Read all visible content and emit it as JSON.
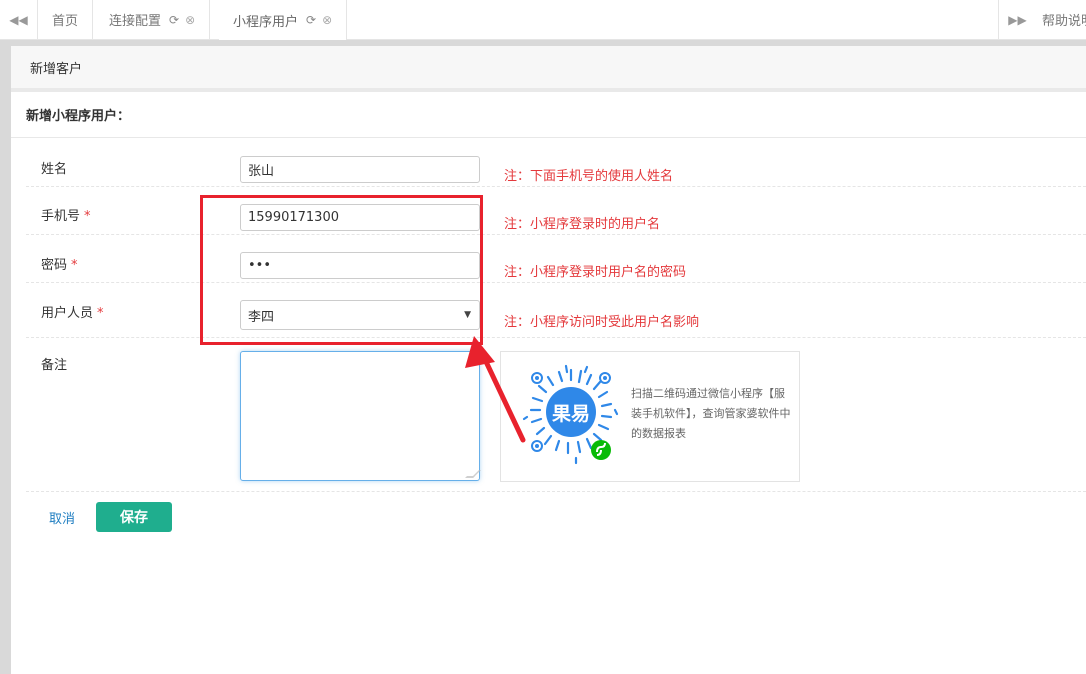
{
  "tabs": {
    "items": [
      {
        "label": "首页"
      },
      {
        "label": "连接配置"
      },
      {
        "label": "小程序用户"
      }
    ],
    "help_label": "帮助说明"
  },
  "panel": {
    "title": "新增客户",
    "section_title": "新增小程序用户："
  },
  "form": {
    "name": {
      "label": "姓名",
      "value": "张山",
      "note": "注：下面手机号的使用人姓名"
    },
    "phone": {
      "label": "手机号",
      "required_mark": "*",
      "value": "15990171300",
      "note": "注：小程序登录时的用户名"
    },
    "password": {
      "label": "密码",
      "required_mark": "*",
      "value": "•••",
      "note": "注：小程序登录时用户名的密码"
    },
    "user_person": {
      "label": "用户人员",
      "required_mark": "*",
      "value": "李四",
      "note": "注：小程序访问时受此用户名影响"
    },
    "remark": {
      "label": "备注",
      "value": ""
    }
  },
  "qr": {
    "logo_text": "果易",
    "text": "扫描二维码通过微信小程序【服装手机软件】，查询管家婆软件中的数据报表"
  },
  "buttons": {
    "cancel": "取消",
    "save": "保存"
  },
  "colors": {
    "accent_green": "#1fae8e",
    "note_red": "#e4393c",
    "link_blue": "#1f7ec1",
    "highlight_red": "#e8222d",
    "qr_blue": "#2f88e8"
  }
}
